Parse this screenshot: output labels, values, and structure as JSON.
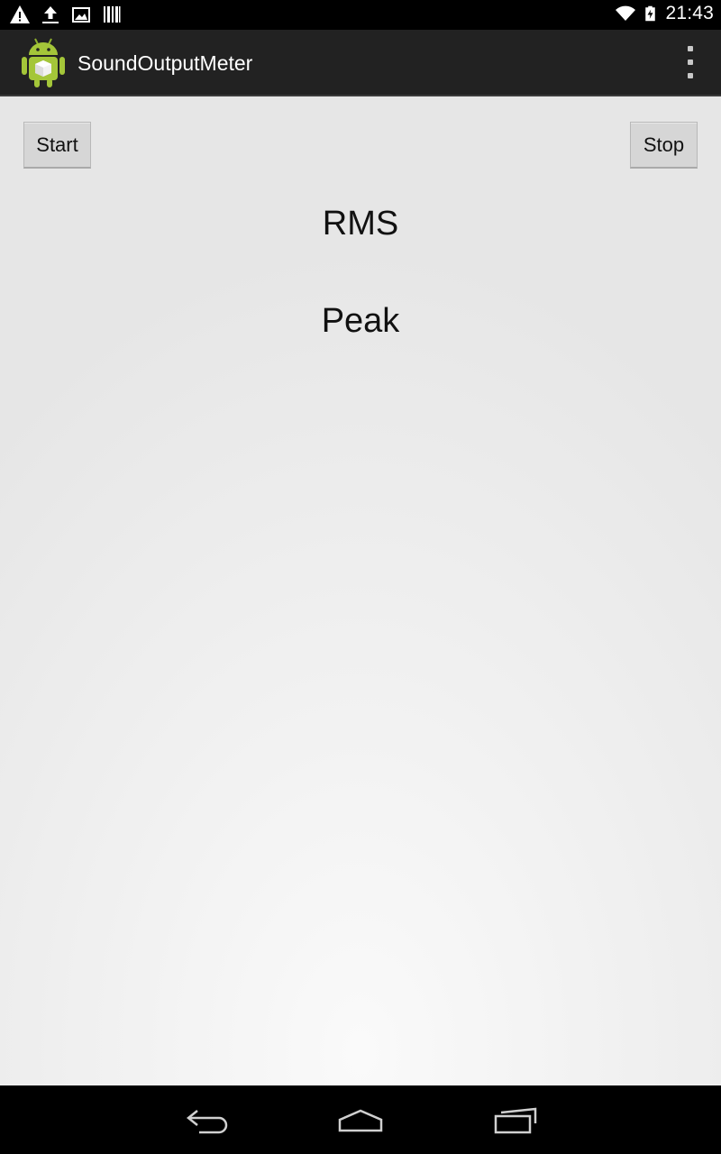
{
  "status_bar": {
    "time": "21:43",
    "icons": [
      "warning-icon",
      "upload-icon",
      "image-icon",
      "barcode-icon",
      "wifi-icon",
      "battery-charging-icon"
    ]
  },
  "action_bar": {
    "title": "SoundOutputMeter",
    "app_icon": "android-robot-icon",
    "overflow_icon": "overflow-menu-icon"
  },
  "content": {
    "start_label": "Start",
    "stop_label": "Stop",
    "rms_label": "RMS",
    "peak_label": "Peak"
  },
  "nav_bar": {
    "icons": [
      "back-icon",
      "home-icon",
      "recents-icon"
    ]
  },
  "colors": {
    "action_bar_bg": "#222222",
    "button_bg": "#d6d6d6",
    "android_green": "#a4c639"
  }
}
